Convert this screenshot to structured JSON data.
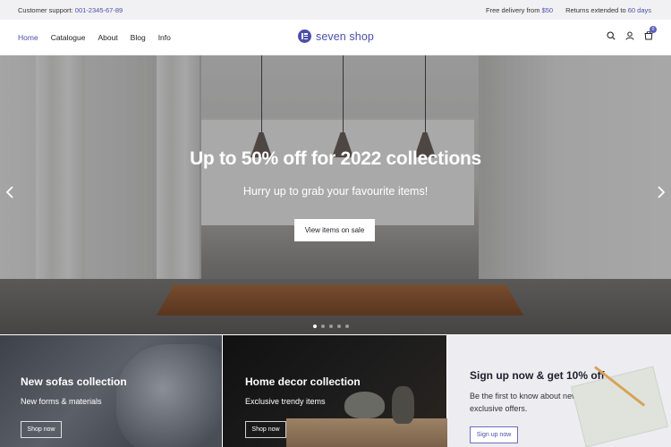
{
  "topbar": {
    "support_label": "Customer support:",
    "support_phone": "001-2345-67-89",
    "delivery_label": "Free delivery from",
    "delivery_value": "$50",
    "returns_label": "Returns extended to",
    "returns_value": "60 days"
  },
  "nav": {
    "items": [
      {
        "label": "Home",
        "active": true
      },
      {
        "label": "Catalogue"
      },
      {
        "label": "About"
      },
      {
        "label": "Blog"
      },
      {
        "label": "Info"
      }
    ]
  },
  "brand": {
    "name": "seven shop",
    "color": "#4b4fa8"
  },
  "header_icons": {
    "search": "search-icon",
    "account": "user-icon",
    "cart": "cart-icon",
    "cart_count": "0"
  },
  "hero": {
    "title": "Up to 50% off for 2022 collections",
    "subtitle": "Hurry up to grab your favourite items!",
    "button": "View items on sale",
    "prev_icon": "chevron-left-icon",
    "next_icon": "chevron-right-icon",
    "slide_count": 5,
    "active_slide": 1
  },
  "cards": [
    {
      "title": "New sofas collection",
      "subtitle": "New forms & materials",
      "button": "Shop now"
    },
    {
      "title": "Home decor collection",
      "subtitle": "Exclusive trendy items",
      "button": "Shop now"
    },
    {
      "title": "Sign up now & get 10% off",
      "subtitle": "Be the first to know about new arrivals and exclusive offers.",
      "button": "Sign up now"
    }
  ]
}
